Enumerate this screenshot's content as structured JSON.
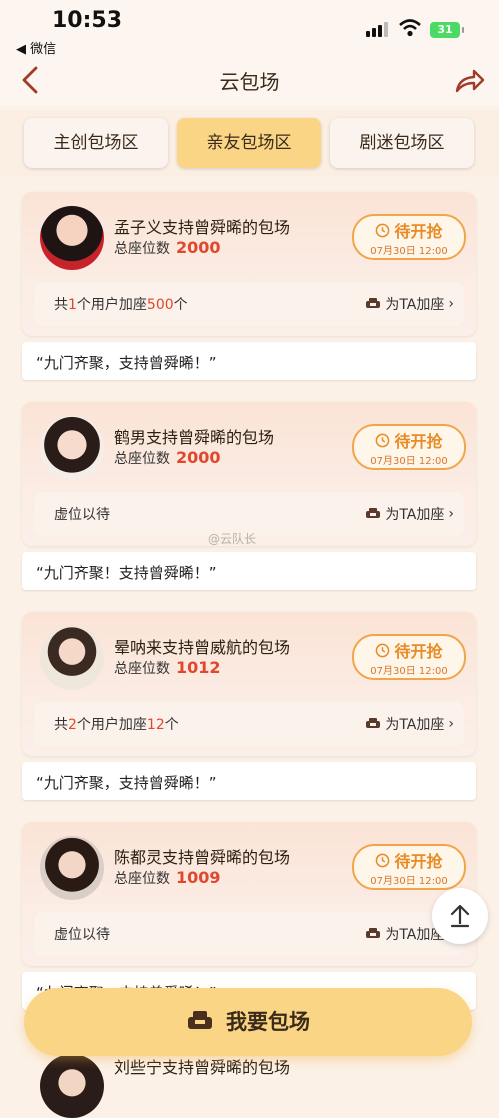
{
  "status_bar": {
    "time": "10:53",
    "back_app": "◀ 微信",
    "battery": "31"
  },
  "nav": {
    "title": "云包场"
  },
  "tabs": [
    {
      "label": "主创包场区",
      "active": false
    },
    {
      "label": "亲友包场区",
      "active": true
    },
    {
      "label": "剧迷包场区",
      "active": false
    }
  ],
  "cards": [
    {
      "title": "孟子义支持曾舜晞的包场",
      "seats_label": "总座位数",
      "seats": "2000",
      "status": "待开抢",
      "date": "07月30日 12:00",
      "info_pre": "共",
      "users": "1",
      "info_mid": "个用户加座",
      "added": "500",
      "info_post": "个",
      "info_plain": "",
      "add_label": "为TA加座",
      "quote": "“九门齐聚，支持曾舜晞！”"
    },
    {
      "title": "鹤男支持曾舜晞的包场",
      "seats_label": "总座位数",
      "seats": "2000",
      "status": "待开抢",
      "date": "07月30日 12:00",
      "info_plain": "虚位以待",
      "add_label": "为TA加座",
      "quote": "“九门齐聚！支持曾舜晞！”"
    },
    {
      "title": "晕呐来支持曾威航的包场",
      "seats_label": "总座位数",
      "seats": "1012",
      "status": "待开抢",
      "date": "07月30日 12:00",
      "info_pre": "共",
      "users": "2",
      "info_mid": "个用户加座",
      "added": "12",
      "info_post": "个",
      "info_plain": "",
      "add_label": "为TA加座",
      "quote": "“九门齐聚，支持曾舜晞！”"
    },
    {
      "title": "陈都灵支持曾舜晞的包场",
      "seats_label": "总座位数",
      "seats": "1009",
      "status": "待开抢",
      "date": "07月30日 12:00",
      "info_plain": "虚位以待",
      "add_label": "为TA加座",
      "quote": "“九门齐聚，支持曾舜晞！”"
    }
  ],
  "watermark": "@云队长",
  "bottom_button": "我要包场",
  "peek_card": {
    "title": "刘些宁支持曾舜晞的包场"
  },
  "colors": {
    "accent": "#f9d585",
    "highlight": "#e0472c",
    "status": "#e88b24"
  }
}
